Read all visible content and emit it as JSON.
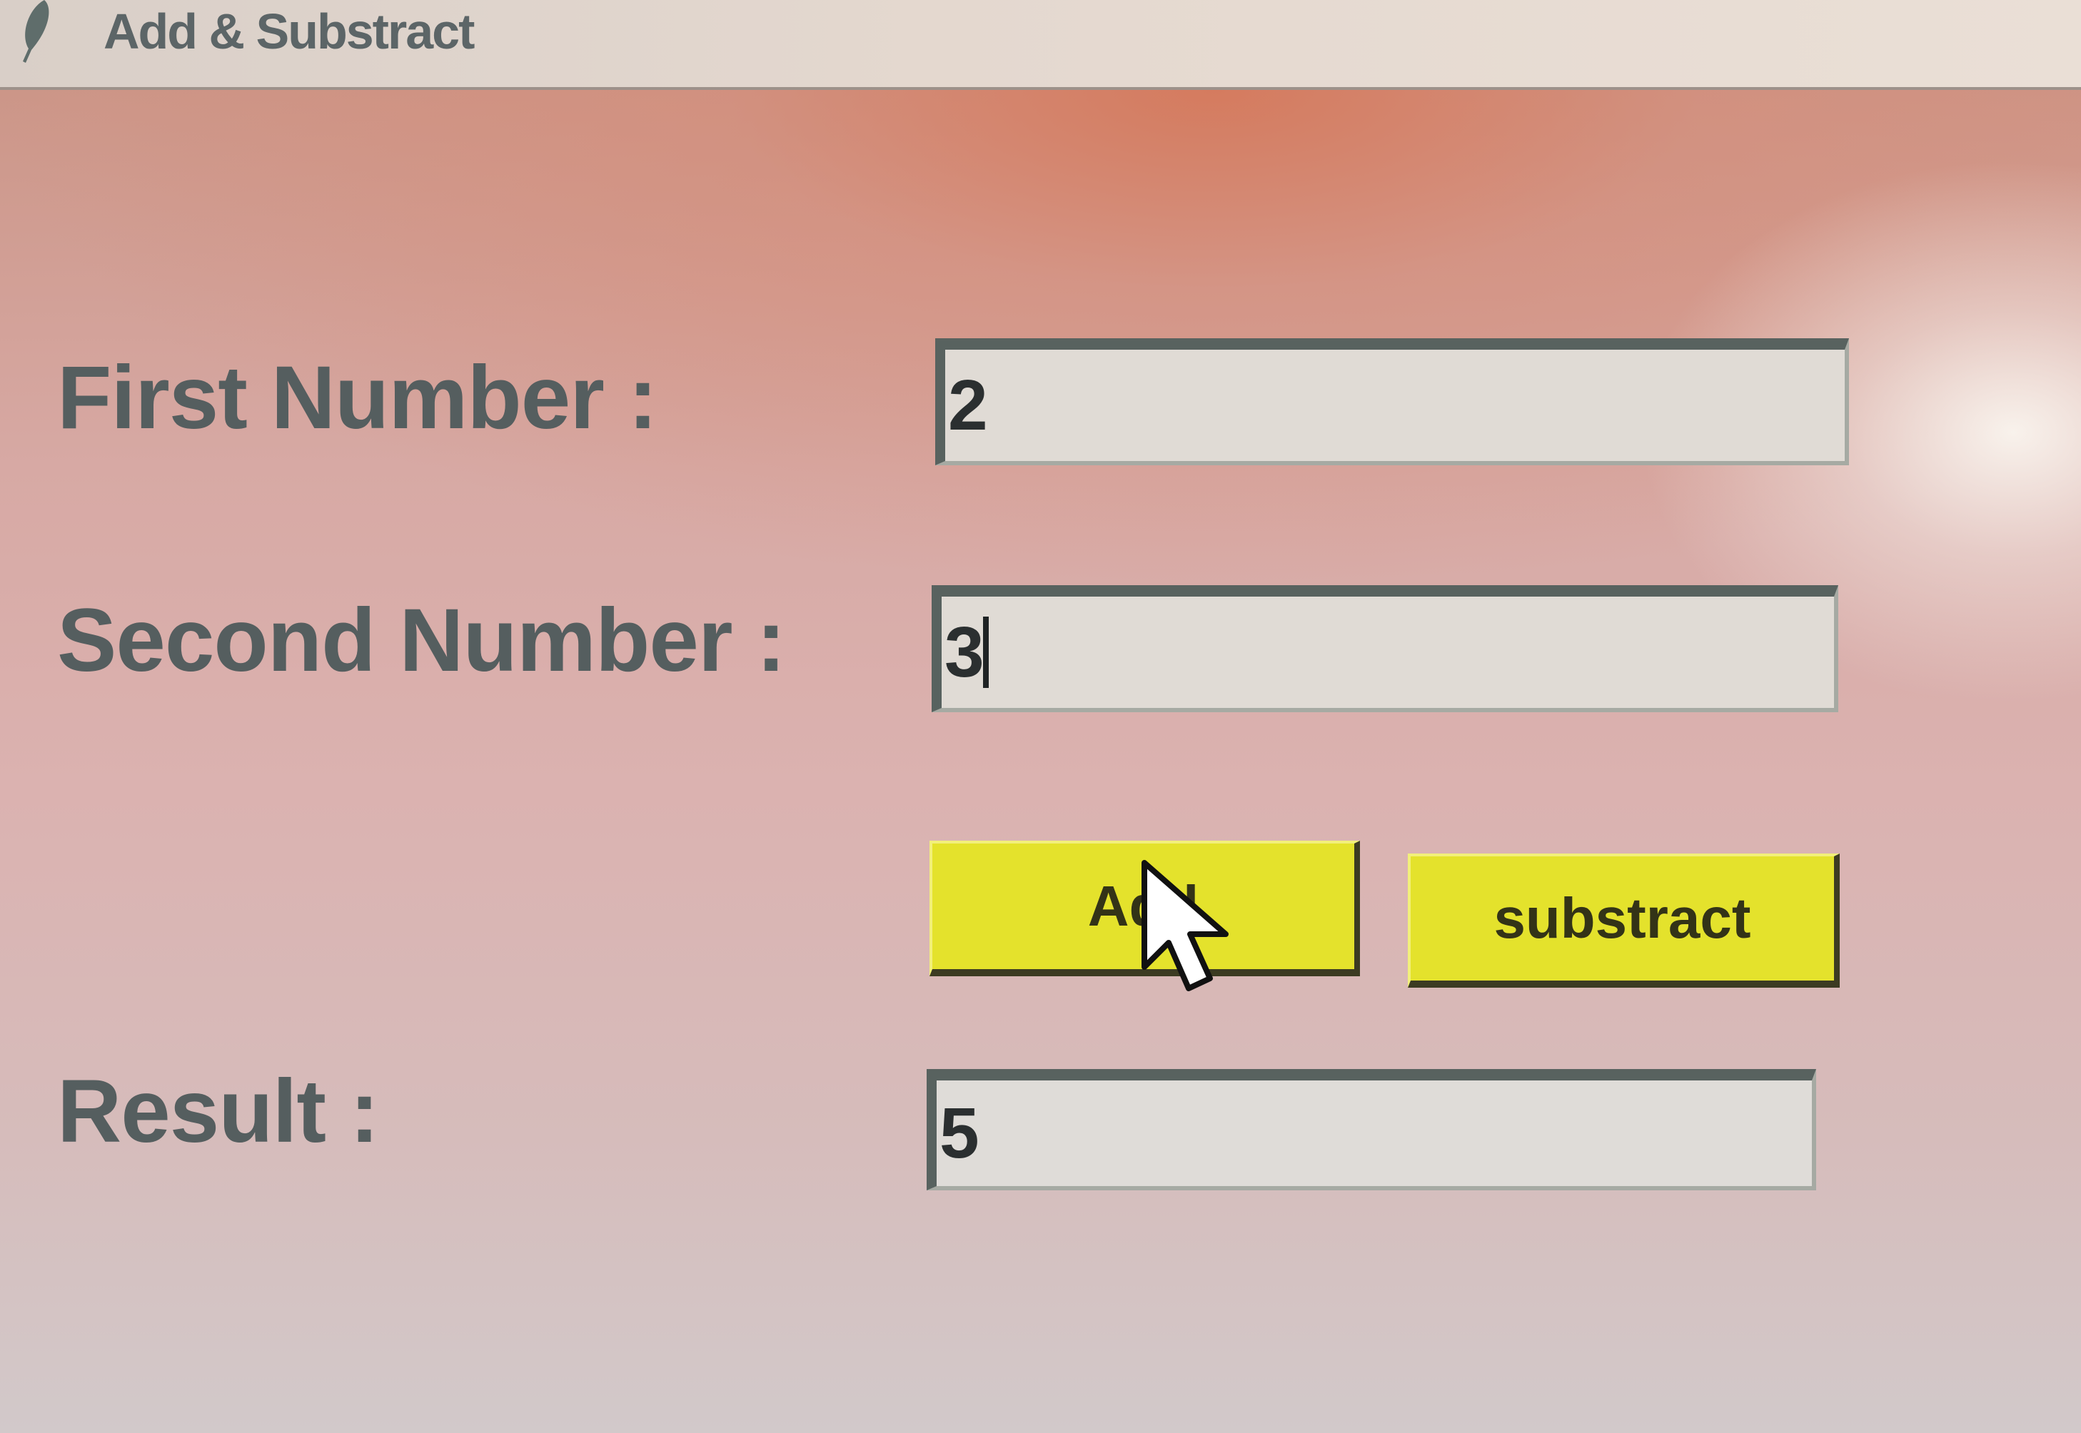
{
  "window": {
    "title": "Add & Substract",
    "icon": "feather-icon"
  },
  "form": {
    "first_label": "First Number :",
    "first_value": "2",
    "second_label": "Second Number :",
    "second_value": "3",
    "result_label": "Result :",
    "result_value": "5"
  },
  "buttons": {
    "add_label": "Add",
    "subtract_label": "substract"
  },
  "colors": {
    "button_yellow": "#e4e22c",
    "label_gray": "#555e5f"
  }
}
